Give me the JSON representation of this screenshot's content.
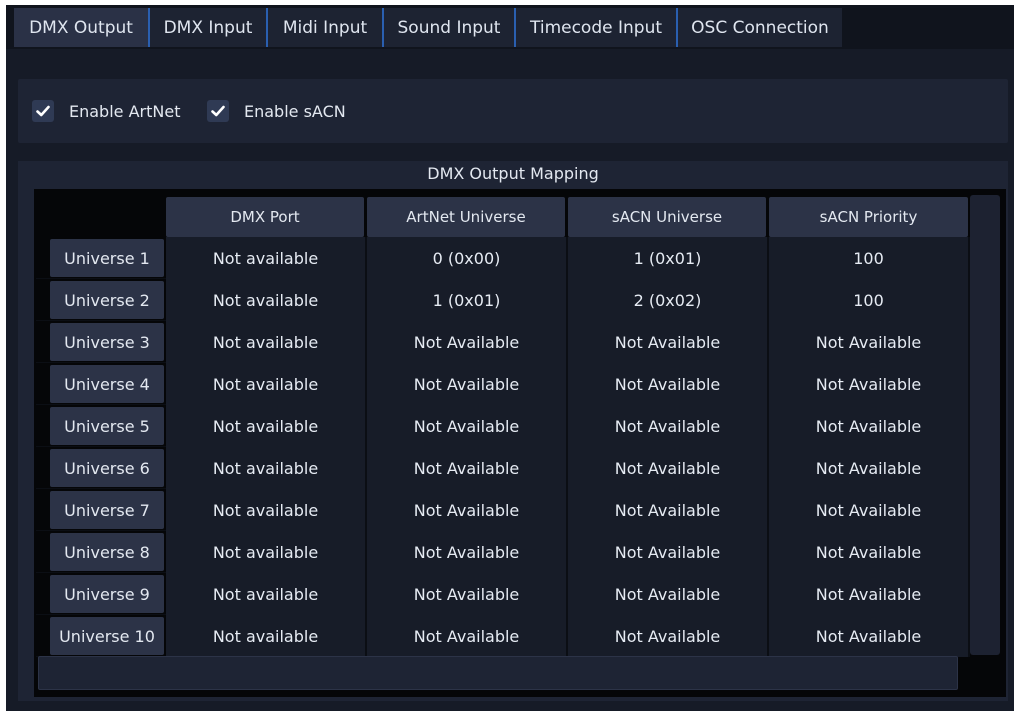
{
  "tabs": [
    {
      "label": "DMX Output",
      "active": true
    },
    {
      "label": "DMX Input"
    },
    {
      "label": "Midi Input"
    },
    {
      "label": "Sound Input"
    },
    {
      "label": "Timecode Input"
    },
    {
      "label": "OSC Connection"
    }
  ],
  "options": {
    "artnet": {
      "label": "Enable ArtNet",
      "checked": true
    },
    "sacn": {
      "label": "Enable sACN",
      "checked": true
    }
  },
  "mapping": {
    "title": "DMX Output Mapping",
    "columns": [
      "DMX Port",
      "ArtNet Universe",
      "sACN Universe",
      "sACN Priority"
    ],
    "rows": [
      {
        "label": "Universe 1",
        "cells": [
          "Not available",
          "0 (0x00)",
          "1 (0x01)",
          "100"
        ]
      },
      {
        "label": "Universe 2",
        "cells": [
          "Not available",
          "1 (0x01)",
          "2 (0x02)",
          "100"
        ]
      },
      {
        "label": "Universe 3",
        "cells": [
          "Not available",
          "Not Available",
          "Not Available",
          "Not Available"
        ]
      },
      {
        "label": "Universe 4",
        "cells": [
          "Not available",
          "Not Available",
          "Not Available",
          "Not Available"
        ]
      },
      {
        "label": "Universe 5",
        "cells": [
          "Not available",
          "Not Available",
          "Not Available",
          "Not Available"
        ]
      },
      {
        "label": "Universe 6",
        "cells": [
          "Not available",
          "Not Available",
          "Not Available",
          "Not Available"
        ]
      },
      {
        "label": "Universe 7",
        "cells": [
          "Not available",
          "Not Available",
          "Not Available",
          "Not Available"
        ]
      },
      {
        "label": "Universe 8",
        "cells": [
          "Not available",
          "Not Available",
          "Not Available",
          "Not Available"
        ]
      },
      {
        "label": "Universe 9",
        "cells": [
          "Not available",
          "Not Available",
          "Not Available",
          "Not Available"
        ]
      },
      {
        "label": "Universe 10",
        "cells": [
          "Not available",
          "Not Available",
          "Not Available",
          "Not Available"
        ]
      }
    ]
  },
  "icons": {
    "checkmark": "check-icon"
  },
  "colors": {
    "accent": "#2a5fb0",
    "background": "#161b27",
    "header": "#2c3347"
  }
}
